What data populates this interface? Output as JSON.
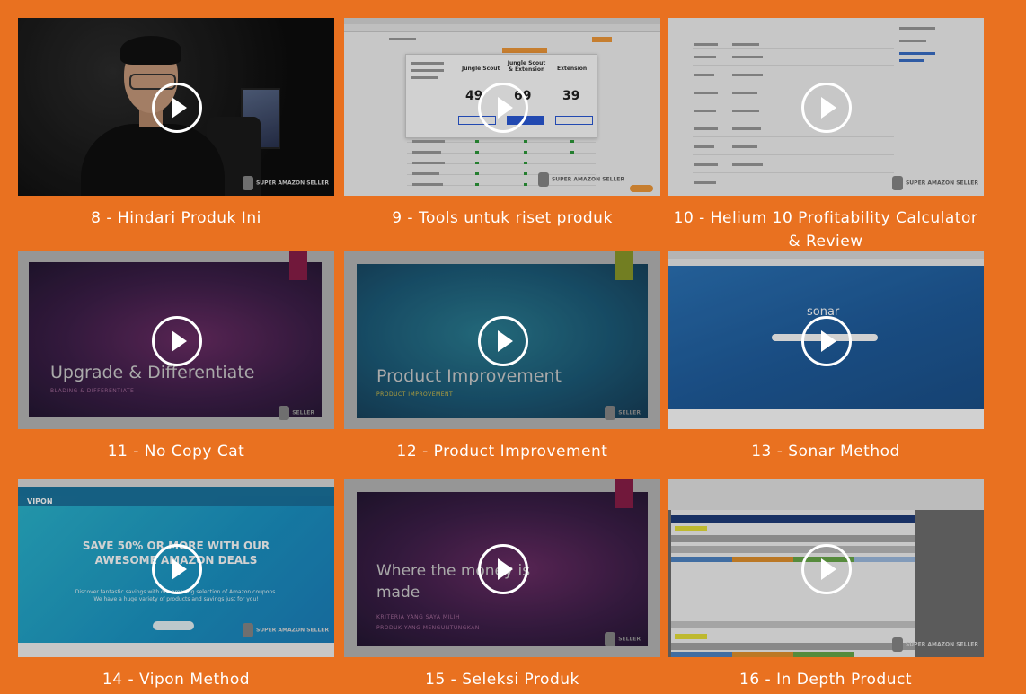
{
  "videos": [
    {
      "caption": "8 - Hindari Produk Ini",
      "thumbnail": "person-talking",
      "badge": "SUPER AMAZON SELLER"
    },
    {
      "caption": "9 - Tools untuk riset produk",
      "thumbnail": "pricing-page",
      "badge": "SUPER AMAZON SELLER",
      "plans": [
        {
          "name": "Jungle Scout",
          "price": "49"
        },
        {
          "name": "Jungle Scout & Extension",
          "price": "69"
        },
        {
          "name": "Extension",
          "price": "39"
        }
      ]
    },
    {
      "caption": "10 - Helium 10 Profitability Calculator & Review",
      "thumbnail": "spreadsheet-page",
      "badge": "SUPER AMAZON SELLER"
    },
    {
      "caption": "11 - No Copy Cat",
      "thumbnail": "slide",
      "slide_title": "Upgrade & Differentiate",
      "slide_subtitle": "BLADING & DIFFERENTIATE",
      "badge": "SELLER"
    },
    {
      "caption": "12 - Product Improvement",
      "thumbnail": "slide",
      "slide_title": "Product Improvement",
      "slide_subtitle": "PRODUCT IMPROVEMENT",
      "badge": "SELLER"
    },
    {
      "caption": "13 - Sonar Method",
      "thumbnail": "sonar",
      "sonar_word": "sonar"
    },
    {
      "caption": "14 - Vipon Method",
      "thumbnail": "vipon",
      "vipon_logo": "VIPON",
      "vipon_headline_1": "SAVE 50% OR MORE WITH OUR",
      "vipon_headline_2": "AWESOME AMAZON DEALS",
      "vipon_lead_1": "Discover fantastic savings with our amazing selection of Amazon coupons.",
      "vipon_lead_2": "We have a huge variety of products and savings just for you!",
      "badge": "SUPER AMAZON SELLER"
    },
    {
      "caption": "15 - Seleksi Produk",
      "thumbnail": "slide",
      "slide_title_1": "Where the money is",
      "slide_title_2": "made",
      "slide_sub_1": "KRITERIA YANG SAYA MILIH",
      "slide_sub_2": "PRODUK YANG MENGUNTUNGKAN",
      "badge": "SELLER"
    },
    {
      "caption": "16 - In Depth Product",
      "thumbnail": "excel",
      "badge": "SUPER AMAZON SELLER"
    }
  ],
  "colors": {
    "background": "#e97120",
    "caption": "#ffffff",
    "play": "#ffffff"
  },
  "icons": {
    "play": "play-circle-icon",
    "badge": "robot-logo-icon"
  }
}
